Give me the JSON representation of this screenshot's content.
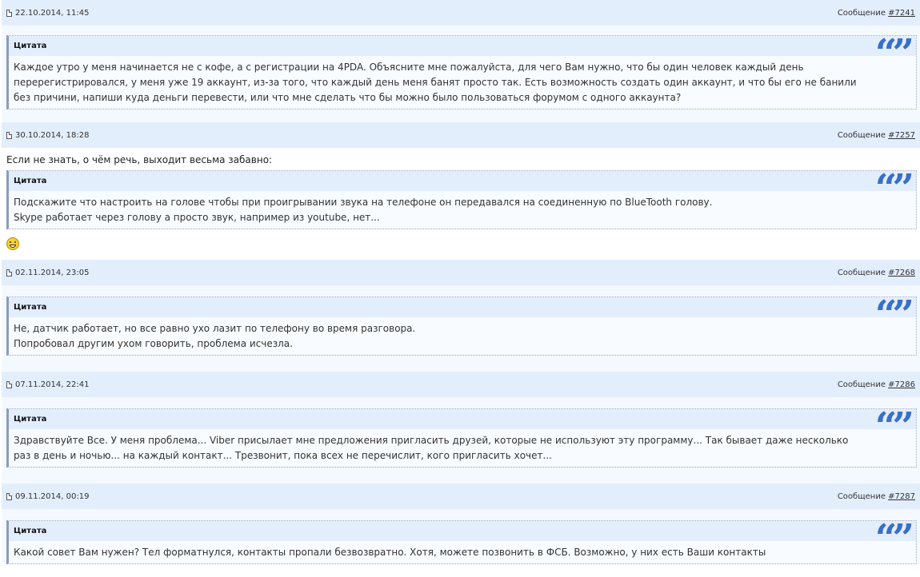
{
  "common": {
    "quote_label": "Цитата",
    "message_label": "Сообщение",
    "quote_icon": "quote-marks-icon",
    "accent_color": "#3a6fc8"
  },
  "posts": [
    {
      "date": "22.10.2014, 11:45",
      "number": "#7241",
      "lead": "",
      "quote": "Каждое утро у меня начинается не с кофе, а с регистрации на 4PDA. Объясните мне пожалуйста, для чего Вам нужно, что бы один человек каждый день перерегистрировался, у меня уже 19 аккаунт, из-за того, что каждый день меня банят просто так. Есть возможность создать один аккаунт, и что бы его не банили без причини, напиши куда деньги перевести, или что мне сделать что бы можно было пользоваться форумом с одного аккаунта?"
    },
    {
      "date": "30.10.2014, 18:28",
      "number": "#7257",
      "lead": "Если не знать, о чём речь, выходит весьма забавно:",
      "quote_line1": "Подскажите что настроить на голове чтобы при проигрывании звука на телефоне он передавался на соединенную по BlueTooth голову.",
      "quote_line2": "Skype работает через голову а просто звук, например из youtube, нет...",
      "smiley": "laugh-smiley-icon"
    },
    {
      "date": "02.11.2014, 23:05",
      "number": "#7268",
      "quote_line1": "Не, датчик работает, но все равно ухо лазит по телефону во время разговора.",
      "quote_line2": "Попробовал другим ухом говорить, проблема исчезла."
    },
    {
      "date": "07.11.2014, 22:41",
      "number": "#7286",
      "quote": "Здравствуйте Все. У меня проблема... Viber присылает мне предложения пригласить друзей, которые не используют эту программу... Так бывает даже несколько раз в день и ночью... на каждый контакт... Трезвонит, пока всех не перечислит, кого пригласить хочет..."
    },
    {
      "date": "09.11.2014, 00:19",
      "number": "#7287",
      "quote": "Какой совет Вам нужен? Тел форматнулся, контакты пропали безвозвратно. Хотя, можете позвонить в ФСБ. Возможно, у них есть Ваши контакты"
    }
  ]
}
